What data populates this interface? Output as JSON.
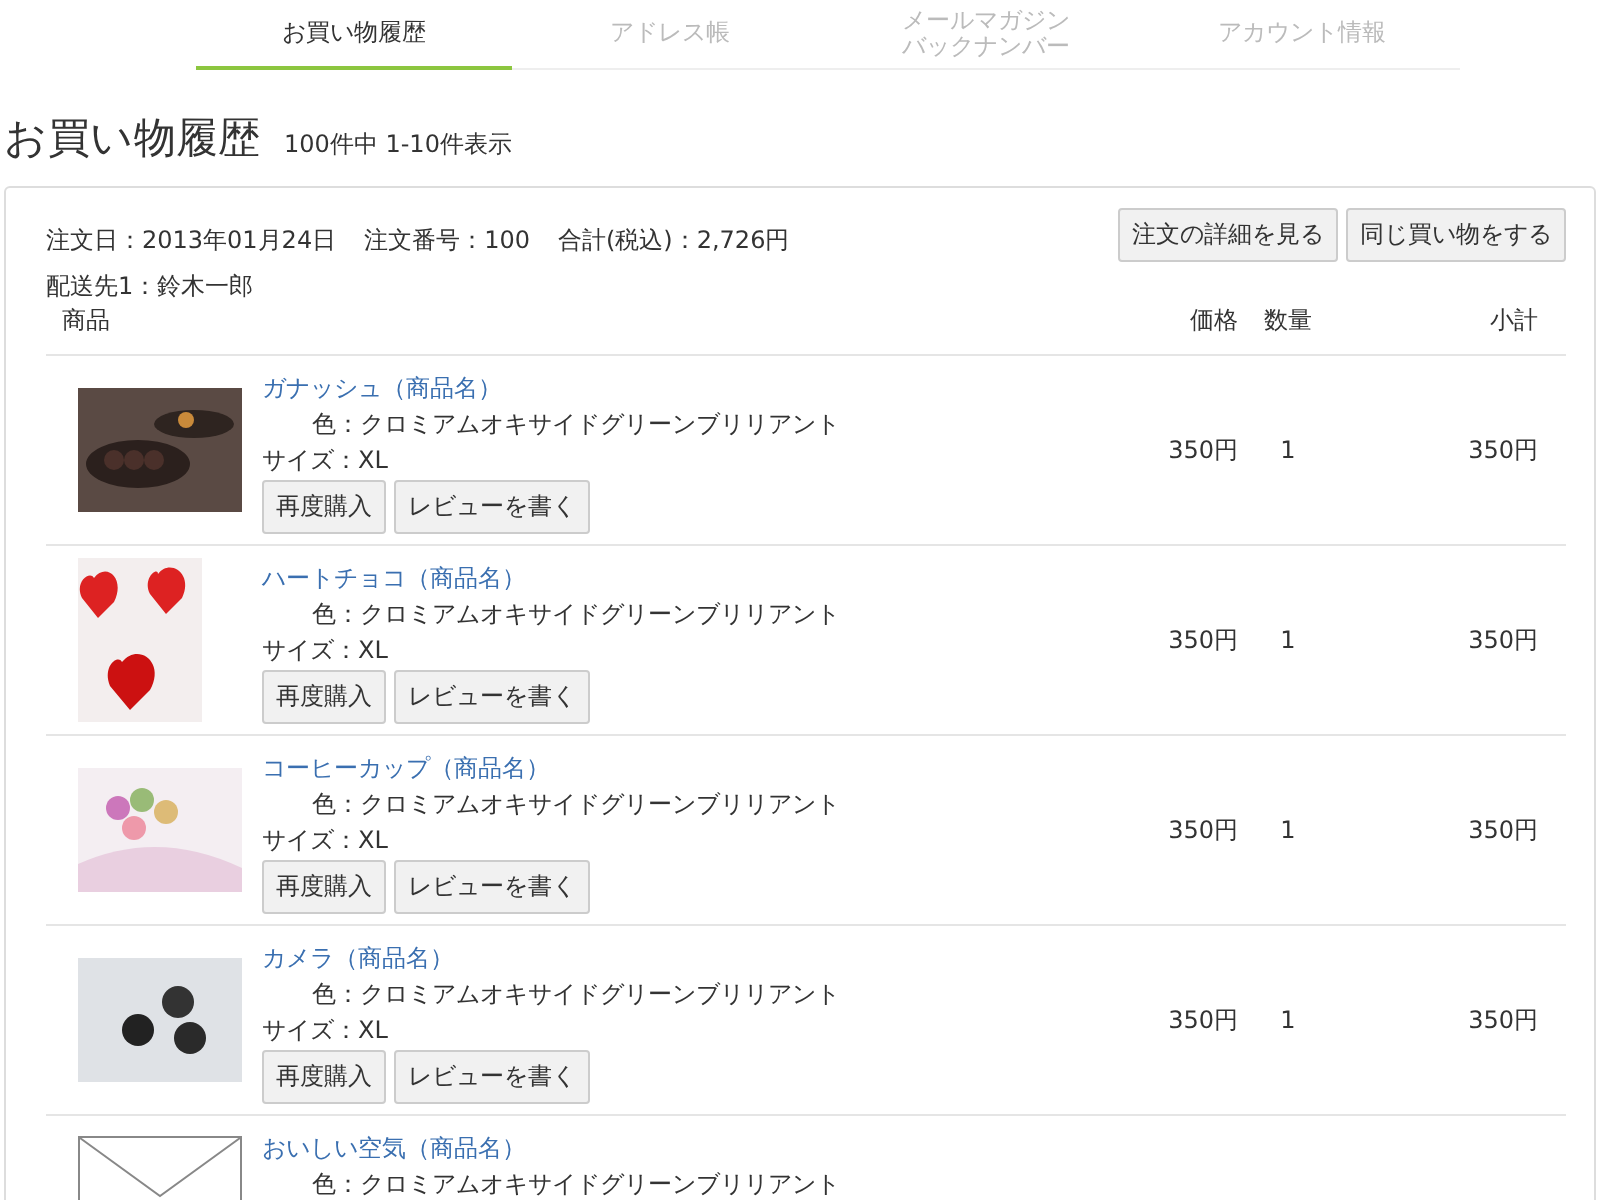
{
  "tabs": [
    {
      "label": "お買い物履歴",
      "selected": true
    },
    {
      "label": "アドレス帳",
      "selected": false
    },
    {
      "label": "メールマガジンバックナンバー",
      "selected": false
    },
    {
      "label": "アカウント情報",
      "selected": false
    }
  ],
  "heading": {
    "title": "お買い物履歴",
    "count": "100件中 1-10件表示"
  },
  "order": {
    "date": "注文日：2013年01月24日",
    "number": "注文番号：100",
    "total": "合計(税込)：2,726円",
    "ship_to": "配送先1：鈴木一郎",
    "buttons": [
      "注文の詳細を見る",
      "同じ買い物をする"
    ]
  },
  "columns": [
    "商品",
    "価格",
    "数量",
    "小計"
  ],
  "items": [
    {
      "kind": "photo",
      "name": "ガナッシュ（商品名）",
      "variant": "色：クロミアムオキサイドグリーンブリリアント",
      "size": "サイズ：XL",
      "buttons": [
        "再度購入",
        "レビューを書く"
      ],
      "price": "350円",
      "qty": "1",
      "subtotal": "350円"
    },
    {
      "kind": "photo",
      "name": "ハートチョコ（商品名）",
      "variant": "色：クロミアムオキサイドグリーンブリリアント",
      "size": "サイズ：XL",
      "buttons": [
        "再度購入",
        "レビューを書く"
      ],
      "price": "350円",
      "qty": "1",
      "subtotal": "350円"
    },
    {
      "kind": "photo",
      "name": "コーヒーカップ（商品名）",
      "variant": "色：クロミアムオキサイドグリーンブリリアント",
      "size": "サイズ：XL",
      "buttons": [
        "再度購入",
        "レビューを書く"
      ],
      "price": "350円",
      "qty": "1",
      "subtotal": "350円"
    },
    {
      "kind": "photo",
      "name": "カメラ（商品名）",
      "variant": "色：クロミアムオキサイドグリーンブリリアント",
      "size": "サイズ：XL",
      "buttons": [
        "再度購入",
        "レビューを書く"
      ],
      "price": "350円",
      "qty": "1",
      "subtotal": "350円"
    },
    {
      "kind": "no-image",
      "name": "おいしい空気（商品名）",
      "variant": "色：クロミアムオキサイドグリーンブリリアント"
    }
  ]
}
